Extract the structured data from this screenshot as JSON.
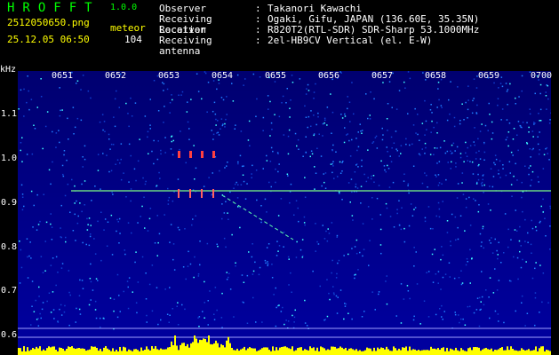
{
  "header": {
    "app_name": "HROFFT",
    "version": "1.0.0",
    "filename": "2512050650.png",
    "datetime": "25.12.05 06:50",
    "meteor_label": "meteor",
    "meteor_count": "104"
  },
  "info": [
    {
      "label": "Observer",
      "value": "Takanori Kawachi"
    },
    {
      "label": "Receiving Location",
      "value": "Ogaki, Gifu, JAPAN (136.60E, 35.35N)"
    },
    {
      "label": "Receiver",
      "value": "R820T2(RTL-SDR) SDR-Sharp 53.1000MHz"
    },
    {
      "label": "Receiving antenna",
      "value": "2el-HB9CV Vertical (el. E-W)"
    }
  ],
  "axes": {
    "unit": "kHz",
    "time_ticks": [
      "0651",
      "0652",
      "0653",
      "0654",
      "0655",
      "0656",
      "0657",
      "0658",
      "0659",
      "0700"
    ],
    "freq_ticks": [
      "1.1",
      "1.0",
      "0.9",
      "0.8",
      "0.7",
      "0.6"
    ]
  },
  "colors": {
    "text_green": "#00ff00",
    "text_yellow": "#ffff00",
    "background_blue": "#000080",
    "noise_cyan": "#00c0ff",
    "carrier": "#80ff80",
    "histogram": "#ffff00"
  }
}
